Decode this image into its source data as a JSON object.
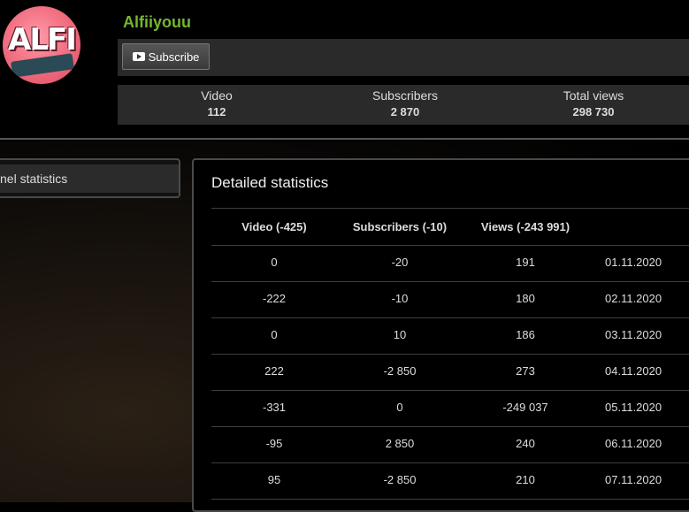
{
  "channel": {
    "name": "Alfiiyouu",
    "avatar_text": "ALFI"
  },
  "subscribe": {
    "label": "Subscribe"
  },
  "stats": [
    {
      "label": "Video",
      "value": "112"
    },
    {
      "label": "Subscribers",
      "value": "2 870"
    },
    {
      "label": "Total views",
      "value": "298 730"
    }
  ],
  "sidebar": {
    "tab_label": "nel statistics"
  },
  "detailed": {
    "title": "Detailed statistics",
    "headers": [
      "Video (-425)",
      "Subscribers (-10)",
      "Views (-243 991)",
      ""
    ],
    "rows": [
      [
        "0",
        "-20",
        "191",
        "01.11.2020"
      ],
      [
        "-222",
        "-10",
        "180",
        "02.11.2020"
      ],
      [
        "0",
        "10",
        "186",
        "03.11.2020"
      ],
      [
        "222",
        "-2 850",
        "273",
        "04.11.2020"
      ],
      [
        "-331",
        "0",
        "-249 037",
        "05.11.2020"
      ],
      [
        "-95",
        "2 850",
        "240",
        "06.11.2020"
      ],
      [
        "95",
        "-2 850",
        "210",
        "07.11.2020"
      ]
    ]
  }
}
